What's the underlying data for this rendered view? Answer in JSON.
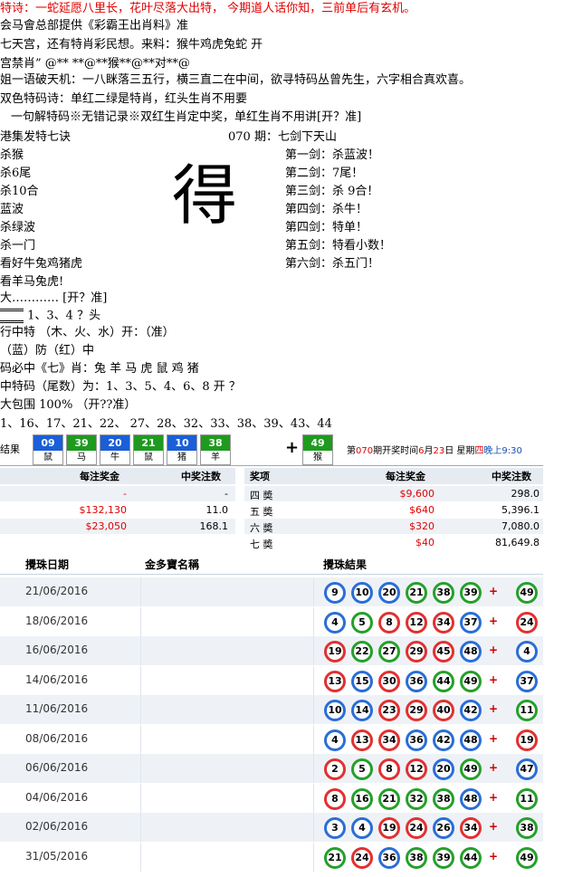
{
  "poem": {
    "line1": "特诗：一蛇延愿八里长，花叶尽落大出特， 今期道人话你知，三前单后有玄机。",
    "line2": "会马會总部提供《彩霸王出肖料》准",
    "line3": "七天宫，还有特肖彩民想。来料：猴牛鸡虎兔蛇 开",
    "line4": "宫禁肖” @** **@**猴**@**对**@",
    "line5": "姐一语破天机：一八眯落三五行，横三直二在中间，欲寻特码丛曾先生，六字相合真欢喜。",
    "line6": "双色特码诗：单红二绿是特肖，红头生肖不用要",
    "line7": "一句解特码※无错记录※双红生肖定中奖，单红生肖不用讲[开？准]"
  },
  "left_list": {
    "title": "港集发特七诀",
    "items": [
      "杀猴",
      "杀6尾",
      "杀10合",
      "蓝波",
      "杀绿波",
      "杀一门",
      "看好牛兔鸡猪虎",
      "看羊马兔虎!"
    ]
  },
  "big_char": "得",
  "right_list": {
    "title": "070 期：七剑下天山",
    "items": [
      "第一剑：杀蓝波！",
      "第二剑：7尾！",
      "第三剑：杀 9合！",
      "第四剑：杀牛！",
      "第四剑：特单！",
      "第五剑：特看小数！",
      "第六剑：杀五门！"
    ]
  },
  "extra_lines": {
    "l1": "大………… [开？准]",
    "l2": "1、3、4 ？头",
    "l3": "行中特  （木、火、水）开：（准）",
    "l4": "（蓝）防（红）中",
    "l5": "码必中《七》肖：兔 羊 马 虎 鼠 鸡  猪",
    "l6": "中特码（尾数）为：1、3、5、4、6、8     开 ？",
    "l7": "大包围 100%      （开??准）",
    "l8": "1、16、17、21、22、 27、28、32、33、38、39、43、44"
  },
  "result": {
    "label": "结果",
    "balls": [
      {
        "num": "09",
        "zodiac": "鼠",
        "color": "blue"
      },
      {
        "num": "39",
        "zodiac": "马",
        "color": "green"
      },
      {
        "num": "20",
        "zodiac": "牛",
        "color": "blue"
      },
      {
        "num": "21",
        "zodiac": "鼠",
        "color": "green"
      },
      {
        "num": "10",
        "zodiac": "猪",
        "color": "blue"
      },
      {
        "num": "38",
        "zodiac": "羊",
        "color": "green"
      }
    ],
    "plus": "+",
    "special": {
      "num": "49",
      "zodiac": "猴",
      "color": "green"
    },
    "draw_info_a": "第",
    "draw_no": "070",
    "draw_info_b": "期开奖时间",
    "draw_month": "6",
    "draw_info_c": "月",
    "draw_day": "23",
    "draw_info_d": "日 星期",
    "draw_weekday": "四",
    "draw_info_e": "晚上",
    "draw_time": "9:30"
  },
  "prizes": {
    "left_headers": [
      "每注奖金",
      "中奖注数"
    ],
    "left_rows": [
      {
        "amount": "-",
        "count": "-"
      },
      {
        "amount": "$132,130",
        "count": "11.0"
      },
      {
        "amount": "$23,050",
        "count": "168.1"
      }
    ],
    "right_headers": [
      "奖项",
      "每注奖金",
      "中奖注数"
    ],
    "right_rows": [
      {
        "name": "四 奬",
        "amount": "$9,600",
        "count": "298.0"
      },
      {
        "name": "五 奬",
        "amount": "$640",
        "count": "5,396.1"
      },
      {
        "name": "六 奬",
        "amount": "$320",
        "count": "7,080.0"
      },
      {
        "name": "七 奬",
        "amount": "$40",
        "count": "81,649.8"
      }
    ]
  },
  "history": {
    "headers": [
      "攪珠日期",
      "金多寶名稱",
      "攪珠結果"
    ],
    "rows": [
      {
        "date": "21/06/2016",
        "balls": [
          [
            "9",
            "b"
          ],
          [
            "10",
            "b"
          ],
          [
            "20",
            "b"
          ],
          [
            "21",
            "g"
          ],
          [
            "38",
            "g"
          ],
          [
            "39",
            "g"
          ]
        ],
        "special": [
          "49",
          "g"
        ]
      },
      {
        "date": "18/06/2016",
        "balls": [
          [
            "4",
            "b"
          ],
          [
            "5",
            "g"
          ],
          [
            "8",
            "r"
          ],
          [
            "12",
            "r"
          ],
          [
            "34",
            "r"
          ],
          [
            "37",
            "b"
          ]
        ],
        "special": [
          "24",
          "r"
        ]
      },
      {
        "date": "16/06/2016",
        "balls": [
          [
            "19",
            "r"
          ],
          [
            "22",
            "g"
          ],
          [
            "27",
            "g"
          ],
          [
            "29",
            "r"
          ],
          [
            "45",
            "r"
          ],
          [
            "48",
            "b"
          ]
        ],
        "special": [
          "4",
          "b"
        ]
      },
      {
        "date": "14/06/2016",
        "balls": [
          [
            "13",
            "r"
          ],
          [
            "15",
            "b"
          ],
          [
            "30",
            "r"
          ],
          [
            "36",
            "b"
          ],
          [
            "44",
            "g"
          ],
          [
            "49",
            "g"
          ]
        ],
        "special": [
          "37",
          "b"
        ]
      },
      {
        "date": "11/06/2016",
        "balls": [
          [
            "10",
            "b"
          ],
          [
            "14",
            "b"
          ],
          [
            "23",
            "r"
          ],
          [
            "29",
            "r"
          ],
          [
            "40",
            "r"
          ],
          [
            "42",
            "b"
          ]
        ],
        "special": [
          "11",
          "g"
        ]
      },
      {
        "date": "08/06/2016",
        "balls": [
          [
            "4",
            "b"
          ],
          [
            "13",
            "r"
          ],
          [
            "34",
            "r"
          ],
          [
            "36",
            "b"
          ],
          [
            "42",
            "b"
          ],
          [
            "48",
            "b"
          ]
        ],
        "special": [
          "19",
          "r"
        ]
      },
      {
        "date": "06/06/2016",
        "balls": [
          [
            "2",
            "r"
          ],
          [
            "5",
            "g"
          ],
          [
            "8",
            "r"
          ],
          [
            "12",
            "r"
          ],
          [
            "20",
            "b"
          ],
          [
            "49",
            "g"
          ]
        ],
        "special": [
          "47",
          "b"
        ]
      },
      {
        "date": "04/06/2016",
        "balls": [
          [
            "8",
            "r"
          ],
          [
            "16",
            "g"
          ],
          [
            "21",
            "g"
          ],
          [
            "32",
            "g"
          ],
          [
            "38",
            "g"
          ],
          [
            "48",
            "b"
          ]
        ],
        "special": [
          "11",
          "g"
        ]
      },
      {
        "date": "02/06/2016",
        "balls": [
          [
            "3",
            "b"
          ],
          [
            "4",
            "b"
          ],
          [
            "19",
            "r"
          ],
          [
            "24",
            "r"
          ],
          [
            "26",
            "b"
          ],
          [
            "34",
            "r"
          ]
        ],
        "special": [
          "38",
          "g"
        ]
      },
      {
        "date": "31/05/2016",
        "balls": [
          [
            "21",
            "g"
          ],
          [
            "24",
            "r"
          ],
          [
            "36",
            "b"
          ],
          [
            "38",
            "g"
          ],
          [
            "39",
            "g"
          ],
          [
            "44",
            "g"
          ]
        ],
        "special": [
          "49",
          "g"
        ]
      }
    ]
  }
}
